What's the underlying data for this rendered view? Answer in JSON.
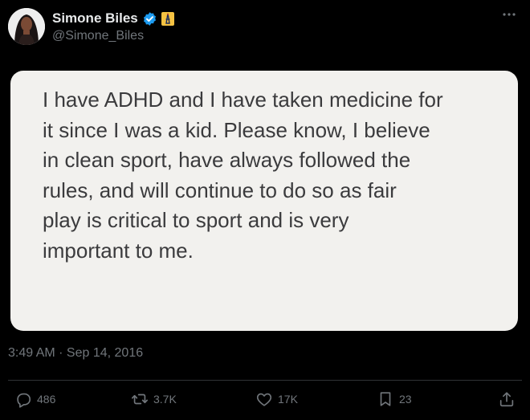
{
  "tweet": {
    "author": {
      "display_name": "Simone Biles",
      "handle": "@Simone_Biles",
      "verified_icon": "verified-badge-icon",
      "affiliation_icon": "usa-gymnastics-affiliation-icon"
    },
    "more_menu_icon": "more-icon",
    "note_text": "I have ADHD and I have taken medicine for\nit since I was a kid. Please know, I believe\nin clean sport, have always followed the\nrules, and will continue to do so as fair\nplay is critical to sport and is very\nimportant to me.",
    "timestamp": "3:49 AM · Sep 14, 2016",
    "actions": {
      "reply_count": "486",
      "retweet_count": "3.7K",
      "like_count": "17K",
      "bookmark_count": "23"
    }
  },
  "colors": {
    "background": "#000000",
    "text_primary": "#e7e9ea",
    "text_secondary": "#71767b",
    "verified_blue": "#1d9bf0",
    "note_background": "#f2f1ee",
    "note_text": "#3b3b3d"
  }
}
